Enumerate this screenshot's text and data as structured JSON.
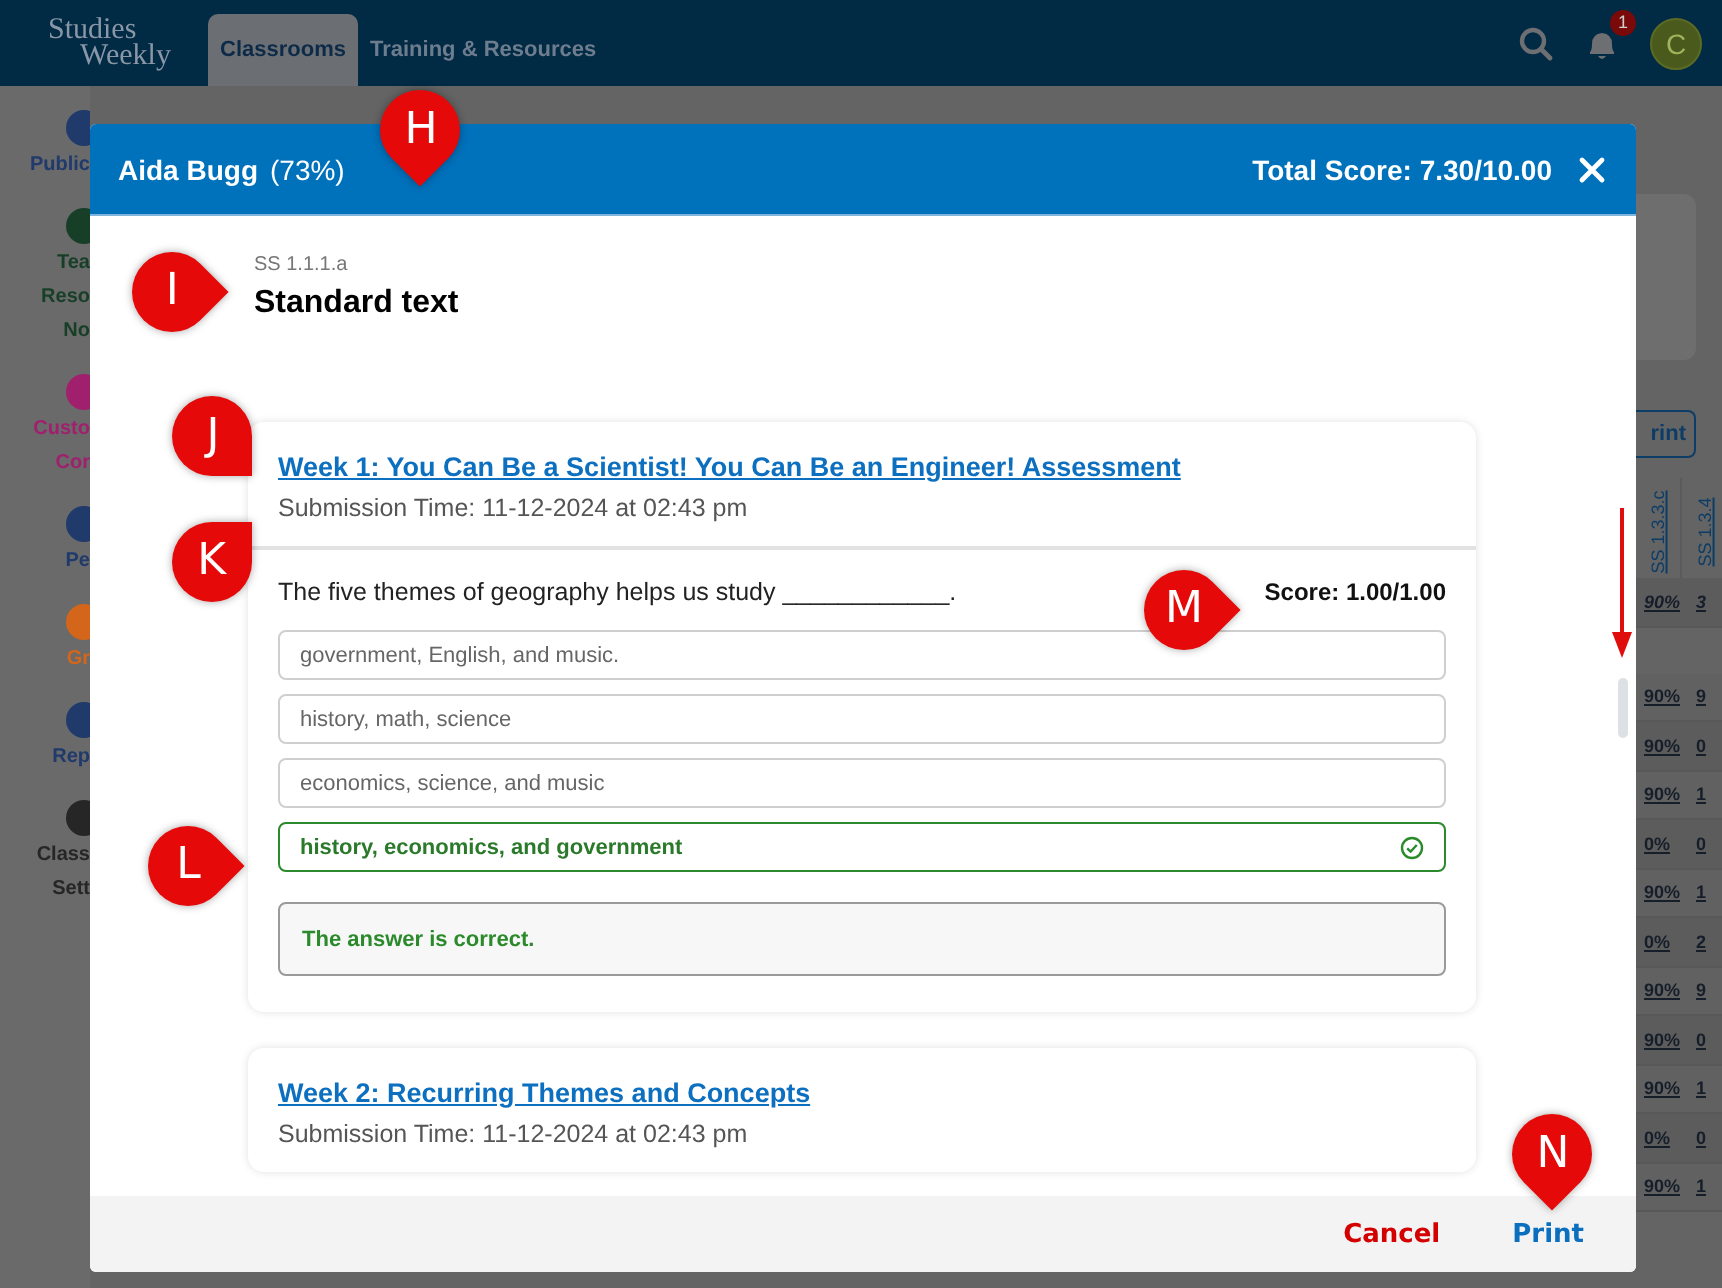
{
  "nav": {
    "logo_lines": [
      "Studies",
      "Weekly"
    ],
    "tabs": [
      {
        "label": "Classrooms",
        "selected": true
      },
      {
        "label": "Training & Resources",
        "selected": false
      }
    ],
    "notification_count": "1",
    "avatar_initial": "C"
  },
  "sidebar": {
    "items": [
      {
        "lines": [
          "Public"
        ],
        "color": "#1f3a6b"
      },
      {
        "lines": [
          "Tea",
          "Reso",
          "No"
        ],
        "color": "#173f28"
      },
      {
        "lines": [
          "Custo",
          "Cor"
        ],
        "color": "#a0206e"
      },
      {
        "lines": [
          "Pe"
        ],
        "color": "#1f3a6b"
      },
      {
        "lines": [
          "Gr"
        ],
        "color": "#d3661a"
      },
      {
        "lines": [
          "Rep"
        ],
        "color": "#1f3a6b"
      },
      {
        "lines": [
          "Class",
          "Sett"
        ],
        "color": "#262626"
      }
    ]
  },
  "background_table": {
    "button": "rint",
    "columns": [
      "SS 1.3.3.c",
      "SS 1.3.4"
    ],
    "rows": [
      [
        "90%",
        "3"
      ],
      [
        "90%",
        "9"
      ],
      [
        "90%",
        "0"
      ],
      [
        "90%",
        "1"
      ],
      [
        "0%",
        "0"
      ],
      [
        "90%",
        "1"
      ],
      [
        "0%",
        "2"
      ],
      [
        "90%",
        "9"
      ],
      [
        "90%",
        "0"
      ],
      [
        "90%",
        "1"
      ],
      [
        "0%",
        "0"
      ],
      [
        "90%",
        "1"
      ]
    ]
  },
  "modal": {
    "student": "Aida Bugg",
    "percent": "(73%)",
    "total_score": "Total Score: 7.30/10.00",
    "standard_code": "SS 1.1.1.a",
    "standard_title": "Standard text",
    "assignments": [
      {
        "title": "Week 1: You Can Be a Scientist! You Can Be an Engineer! Assessment",
        "submission": "Submission Time: 11-12-2024 at 02:43 pm",
        "expanded": true,
        "question": {
          "prompt": "The five themes of geography helps us study ____________.",
          "score": "Score: 1.00/1.00",
          "options": [
            {
              "text": "government, English, and music.",
              "selected": false
            },
            {
              "text": "history, math, science",
              "selected": false
            },
            {
              "text": "economics, science, and music",
              "selected": false
            },
            {
              "text": "history, economics, and government",
              "selected": true
            }
          ],
          "feedback": {
            "text": "The answer is correct.",
            "correct": true
          }
        }
      },
      {
        "title": "Week 2: Recurring Themes and Concepts",
        "submission": "Submission Time: 11-12-2024 at 02:43 pm",
        "expanded": false
      }
    ],
    "footer": {
      "cancel": "Cancel",
      "print": "Print"
    }
  },
  "callouts": [
    {
      "letter": "H"
    },
    {
      "letter": "I"
    },
    {
      "letter": "J"
    },
    {
      "letter": "K"
    },
    {
      "letter": "L"
    },
    {
      "letter": "M"
    },
    {
      "letter": "N"
    }
  ]
}
